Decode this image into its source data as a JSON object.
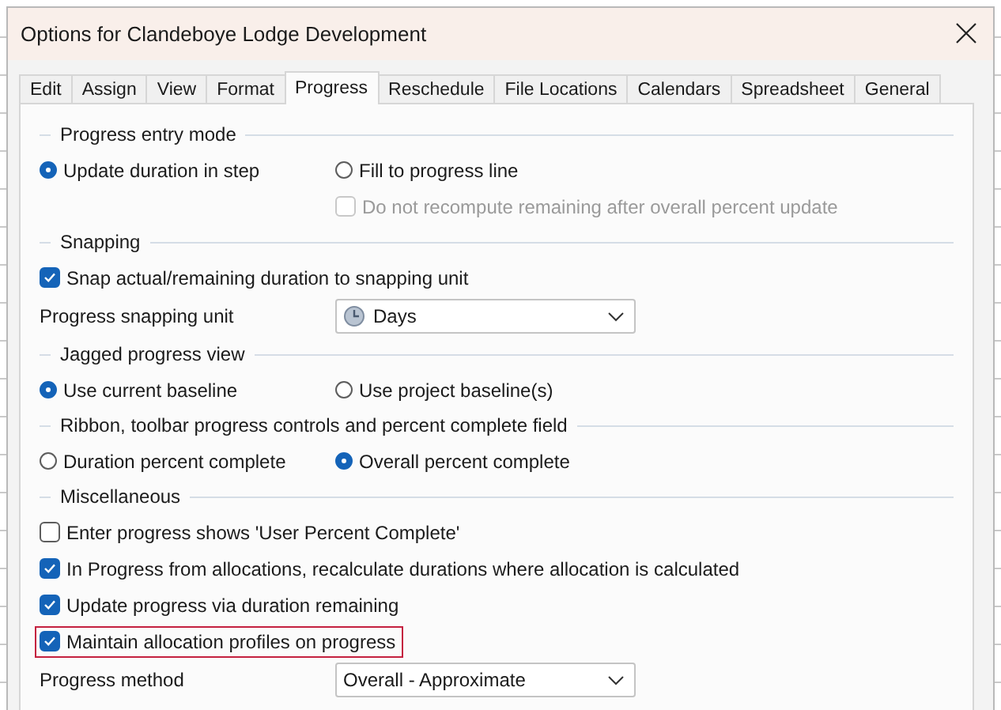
{
  "window": {
    "title": "Options for Clandeboye Lodge Development"
  },
  "tabs": [
    {
      "label": "Edit",
      "selected": false
    },
    {
      "label": "Assign",
      "selected": false
    },
    {
      "label": "View",
      "selected": false
    },
    {
      "label": "Format",
      "selected": false
    },
    {
      "label": "Progress",
      "selected": true
    },
    {
      "label": "Reschedule",
      "selected": false
    },
    {
      "label": "File Locations",
      "selected": false
    },
    {
      "label": "Calendars",
      "selected": false
    },
    {
      "label": "Spreadsheet",
      "selected": false
    },
    {
      "label": "General",
      "selected": false
    }
  ],
  "sections": [
    {
      "title": "Progress entry mode",
      "rows": [
        {
          "kind": "radios",
          "options": [
            {
              "label": "Update duration in step",
              "selected": true
            },
            {
              "label": "Fill to progress line",
              "selected": false
            }
          ]
        },
        {
          "kind": "subcheckbox",
          "label": "Do not recompute remaining after overall percent update",
          "checked": false,
          "disabled": true
        }
      ]
    },
    {
      "title": "Snapping",
      "rows": [
        {
          "kind": "checkbox",
          "label": "Snap actual/remaining duration to snapping unit",
          "checked": true,
          "highlighted": false
        },
        {
          "kind": "unitdropdown",
          "label": "Progress snapping unit",
          "value": "Days"
        }
      ]
    },
    {
      "title": "Jagged progress view",
      "rows": [
        {
          "kind": "radios",
          "options": [
            {
              "label": "Use current baseline",
              "selected": true
            },
            {
              "label": "Use project baseline(s)",
              "selected": false
            }
          ]
        }
      ]
    },
    {
      "title": "Ribbon, toolbar progress controls and percent complete field",
      "rows": [
        {
          "kind": "radios",
          "options": [
            {
              "label": "Duration percent complete",
              "selected": false
            },
            {
              "label": "Overall percent complete",
              "selected": true
            }
          ]
        }
      ]
    },
    {
      "title": "Miscellaneous",
      "rows": [
        {
          "kind": "checkbox",
          "label": "Enter progress shows 'User Percent Complete'",
          "checked": false,
          "highlighted": false
        },
        {
          "kind": "checkbox",
          "label": "In Progress from allocations, recalculate durations where allocation is calculated",
          "checked": true,
          "highlighted": false
        },
        {
          "kind": "checkbox",
          "label": "Update progress via duration remaining",
          "checked": true,
          "highlighted": false
        },
        {
          "kind": "checkbox",
          "label": "Maintain allocation profiles on progress",
          "checked": true,
          "highlighted": true
        },
        {
          "kind": "dropdown",
          "label": "Progress method",
          "value": "Overall - Approximate"
        }
      ]
    }
  ]
}
